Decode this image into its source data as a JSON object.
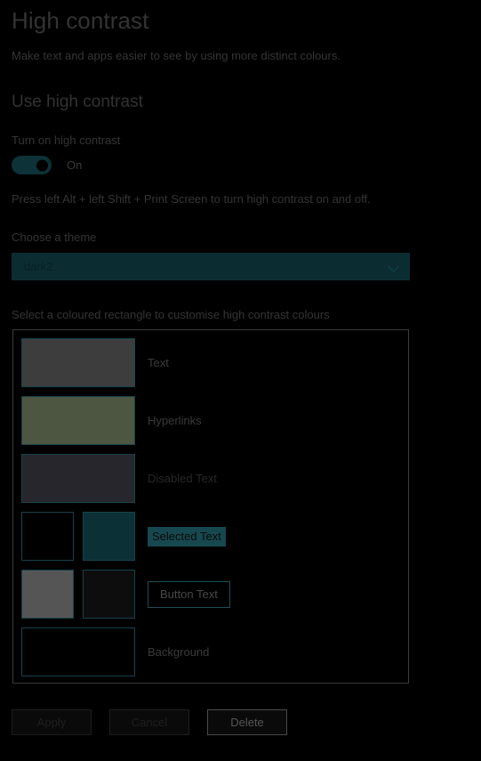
{
  "page": {
    "title": "High contrast",
    "subtitle": "Make text and apps easier to see by using more distinct colours.",
    "section_heading": "Use high contrast"
  },
  "toggle": {
    "label": "Turn on high contrast",
    "state": "On",
    "track_color": "#0d3237",
    "knob_color": "#000000"
  },
  "hint": {
    "text": "Press left Alt + left Shift + Print Screen to turn high contrast on and off."
  },
  "theme": {
    "label": "Choose a theme",
    "selected": "dark2",
    "options": [
      "dark2"
    ],
    "chevron_icon": "chevron-down-icon",
    "background_color": "#0b2d32",
    "text_color": "#062126"
  },
  "swatches": {
    "intro": "Select a coloured rectangle to customise high contrast colours",
    "rows": [
      {
        "label": "Text",
        "label_style": "plain",
        "chips": [
          {
            "color": "#3d3d3d",
            "size": "full"
          }
        ]
      },
      {
        "label": "Hyperlinks",
        "label_style": "plain",
        "chips": [
          {
            "color": "#4c5641",
            "size": "full"
          }
        ]
      },
      {
        "label": "Disabled Text",
        "label_style": "disabled",
        "chips": [
          {
            "color": "#26262c",
            "size": "full"
          }
        ]
      },
      {
        "label": "Selected Text",
        "label_style": "selected",
        "chips": [
          {
            "color": "#000000",
            "size": "half"
          },
          {
            "color": "#0b3036",
            "size": "half"
          }
        ]
      },
      {
        "label": "Button Text",
        "label_style": "buttonish",
        "chips": [
          {
            "color": "#555555",
            "size": "half"
          },
          {
            "color": "#0d0d0d",
            "size": "half"
          }
        ]
      },
      {
        "label": "Background",
        "label_style": "plain",
        "chips": [
          {
            "color": "#000000",
            "size": "full"
          }
        ]
      }
    ],
    "border_color": "#3c3c3c",
    "chip_border_color": "#164349"
  },
  "footer": {
    "buttons": [
      {
        "label": "Apply",
        "enabled": false
      },
      {
        "label": "Cancel",
        "enabled": false
      },
      {
        "label": "Delete",
        "enabled": true
      }
    ]
  }
}
